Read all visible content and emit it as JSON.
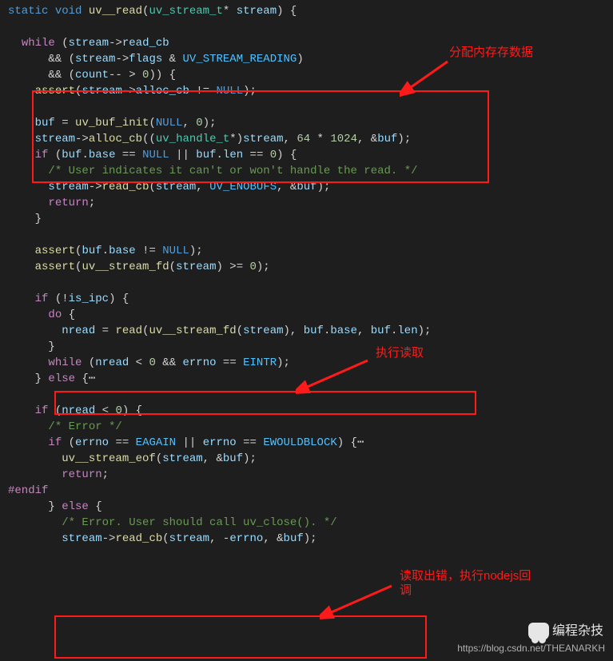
{
  "annotations": {
    "a1": "分配内存存数据",
    "a2": "执行读取",
    "a3_l1": "读取出错，执行nodejs回",
    "a3_l2": "调"
  },
  "watermark": "https://blog.csdn.net/THEANARKH",
  "brand": "编程杂技",
  "code": {
    "l01_a": "static",
    "l01_b": "void",
    "l01_c": "uv__read",
    "l01_d": "uv_stream_t",
    "l01_e": "stream",
    "l02": "",
    "l03_a": "while",
    "l03_b": "stream",
    "l03_c": "read_cb",
    "l04_a": "stream",
    "l04_b": "flags",
    "l04_c": "UV_STREAM_READING",
    "l05_a": "count",
    "l05_b": "0",
    "l06_a": "assert",
    "l06_b": "stream",
    "l06_c": "alloc_cb",
    "l06_d": "NULL",
    "l07": "",
    "l08_a": "buf",
    "l08_b": "uv_buf_init",
    "l08_c": "NULL",
    "l08_d": "0",
    "l09_a": "stream",
    "l09_b": "alloc_cb",
    "l09_c": "uv_handle_t",
    "l09_d": "stream",
    "l09_e": "64",
    "l09_f": "1024",
    "l09_g": "buf",
    "l10_a": "if",
    "l10_b": "buf",
    "l10_c": "base",
    "l10_d": "NULL",
    "l10_e": "buf",
    "l10_f": "len",
    "l10_g": "0",
    "l11": "/* User indicates it can't or won't handle the read. */",
    "l12_a": "stream",
    "l12_b": "read_cb",
    "l12_c": "stream",
    "l12_d": "UV_ENOBUFS",
    "l12_e": "buf",
    "l13": "return",
    "l14": "}",
    "l15": "",
    "l16_a": "assert",
    "l16_b": "buf",
    "l16_c": "base",
    "l16_d": "NULL",
    "l17_a": "assert",
    "l17_b": "uv__stream_fd",
    "l17_c": "stream",
    "l17_d": "0",
    "l18": "",
    "l19_a": "if",
    "l19_b": "is_ipc",
    "l20": "do",
    "l21_a": "nread",
    "l21_b": "read",
    "l21_c": "uv__stream_fd",
    "l21_d": "stream",
    "l21_e": "buf",
    "l21_f": "base",
    "l21_g": "buf",
    "l21_h": "len",
    "l22": "}",
    "l23_a": "while",
    "l23_b": "nread",
    "l23_c": "0",
    "l23_d": "errno",
    "l23_e": "EINTR",
    "l24_a": "else",
    "l25": "",
    "l26_a": "if",
    "l26_b": "nread",
    "l26_c": "0",
    "l27": "/* Error */",
    "l28_a": "if",
    "l28_b": "errno",
    "l28_c": "EAGAIN",
    "l28_d": "errno",
    "l28_e": "EWOULDBLOCK",
    "l29_a": "uv__stream_eof",
    "l29_b": "stream",
    "l29_c": "buf",
    "l30": "return",
    "l31": "#endif",
    "l32": "else",
    "l33": "/* Error. User should call uv_close(). */",
    "l34_a": "stream",
    "l34_b": "read_cb",
    "l34_c": "stream",
    "l34_d": "errno",
    "l34_e": "buf"
  }
}
